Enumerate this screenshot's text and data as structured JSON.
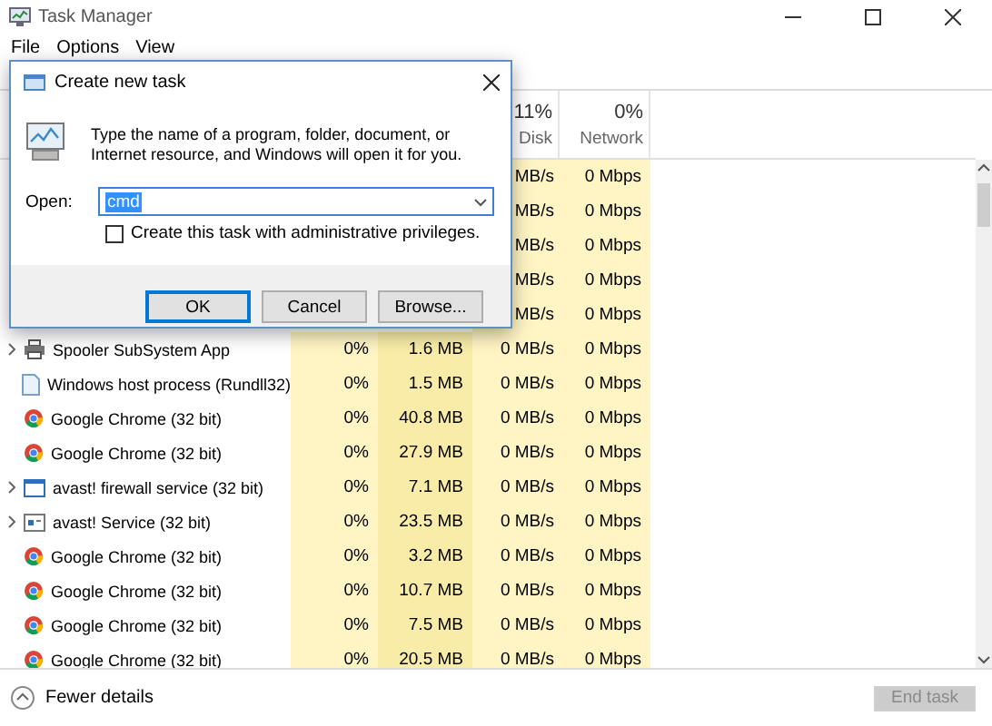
{
  "window": {
    "title": "Task Manager"
  },
  "menu": [
    "File",
    "Options",
    "View"
  ],
  "header": {
    "disk": {
      "percent": "11%",
      "label": "Disk"
    },
    "network": {
      "percent": "0%",
      "label": "Network"
    }
  },
  "rows": [
    {
      "disk": "MB/s",
      "network": "0 Mbps"
    },
    {
      "disk": "MB/s",
      "network": "0 Mbps"
    },
    {
      "disk": "MB/s",
      "network": "0 Mbps"
    },
    {
      "disk": "MB/s",
      "network": "0 Mbps"
    },
    {
      "disk": "MB/s",
      "network": "0 Mbps"
    },
    {
      "expandable": true,
      "kind": "printer",
      "name": "Spooler SubSystem App",
      "cpu": "0%",
      "memory": "1.6 MB",
      "disk": "0 MB/s",
      "network": "0 Mbps"
    },
    {
      "expandable": false,
      "kind": "document",
      "name": "Windows host process (Rundll32)",
      "cpu": "0%",
      "memory": "1.5 MB",
      "disk": "0 MB/s",
      "network": "0 Mbps"
    },
    {
      "expandable": false,
      "kind": "chrome",
      "name": "Google Chrome (32 bit)",
      "cpu": "0%",
      "memory": "40.8 MB",
      "disk": "0 MB/s",
      "network": "0 Mbps"
    },
    {
      "expandable": false,
      "kind": "chrome",
      "name": "Google Chrome (32 bit)",
      "cpu": "0%",
      "memory": "27.9 MB",
      "disk": "0 MB/s",
      "network": "0 Mbps"
    },
    {
      "expandable": true,
      "kind": "window",
      "name": "avast! firewall service (32 bit)",
      "cpu": "0%",
      "memory": "7.1 MB",
      "disk": "0 MB/s",
      "network": "0 Mbps"
    },
    {
      "expandable": true,
      "kind": "service",
      "name": "avast! Service (32 bit)",
      "cpu": "0%",
      "memory": "23.5 MB",
      "disk": "0 MB/s",
      "network": "0 Mbps"
    },
    {
      "expandable": false,
      "kind": "chrome",
      "name": "Google Chrome (32 bit)",
      "cpu": "0%",
      "memory": "3.2 MB",
      "disk": "0 MB/s",
      "network": "0 Mbps"
    },
    {
      "expandable": false,
      "kind": "chrome",
      "name": "Google Chrome (32 bit)",
      "cpu": "0%",
      "memory": "10.7 MB",
      "disk": "0 MB/s",
      "network": "0 Mbps"
    },
    {
      "expandable": false,
      "kind": "chrome",
      "name": "Google Chrome (32 bit)",
      "cpu": "0%",
      "memory": "7.5 MB",
      "disk": "0 MB/s",
      "network": "0 Mbps"
    },
    {
      "expandable": false,
      "kind": "chrome",
      "name": "Google Chrome (32 bit)",
      "cpu": "0%",
      "memory": "20.5 MB",
      "disk": "0 MB/s",
      "network": "0 Mbps"
    }
  ],
  "footer": {
    "fewer_details": "Fewer details",
    "end_task": {
      "label": "End task",
      "disabled": true
    }
  },
  "dialog": {
    "title": "Create new task",
    "message": "Type the name of a program, folder, document, or Internet resource, and Windows will open it for you.",
    "open_label": "Open:",
    "value": "cmd",
    "value_selected": true,
    "admin": {
      "label": "Create this task with administrative privileges.",
      "checked": false
    },
    "buttons": [
      {
        "label": "OK",
        "default": true
      },
      {
        "label": "Cancel",
        "default": false
      },
      {
        "label": "Browse...",
        "default": false
      }
    ]
  }
}
